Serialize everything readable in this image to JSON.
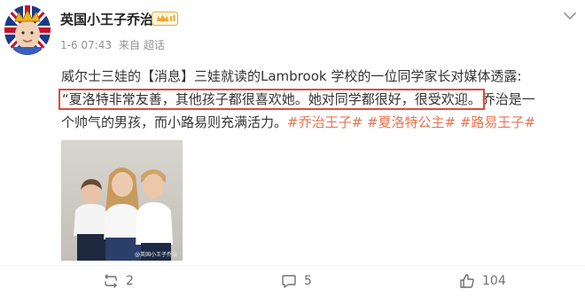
{
  "post": {
    "author": "英国小王子乔治",
    "date": "1-6 07:43",
    "source_prefix": "来自",
    "source": "超话",
    "line1": "威尔士三娃的【消息】三娃就读的Lambrook 学校的一位同学家长对媒体透露:",
    "quote_highlight": "“夏洛特非常友善，其他孩子都很喜欢她。她对同学都很好，很受欢迎。",
    "line2_rest": "乔治是一",
    "line3_text": "个帅气的男孩，而小路易则充满活力。",
    "tags": [
      "#乔治王子#",
      "#夏洛特公主#",
      "#路易王子#"
    ],
    "watermark": "@英国小王子乔治"
  },
  "actions": {
    "repost_count": "2",
    "comment_count": "5",
    "like_count": "104"
  },
  "colors": {
    "tag": "#eb7350",
    "highlight_box": "#e04a3a",
    "badge": "#f5a623"
  },
  "icons": {
    "more": "chevron-down-icon",
    "vip": "crown-badge-icon",
    "repost": "repost-icon",
    "comment": "comment-icon",
    "like": "thumbs-up-icon"
  }
}
